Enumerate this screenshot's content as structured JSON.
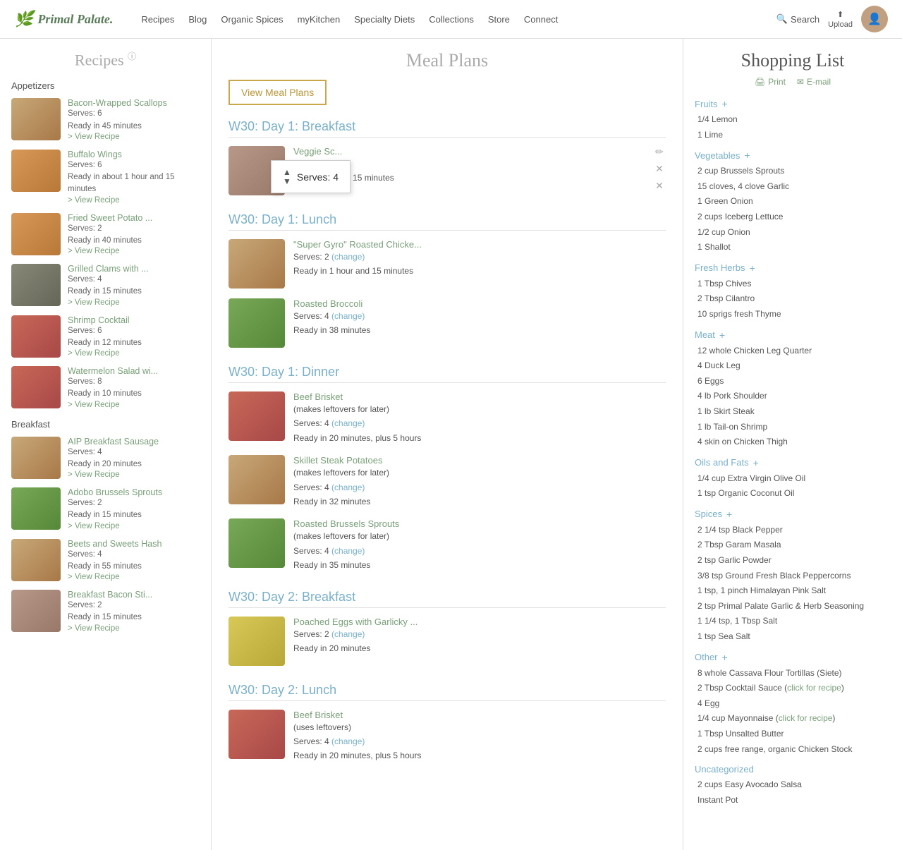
{
  "header": {
    "logo_text": "Primal Palate.",
    "nav_items": [
      {
        "label": "Recipes",
        "href": "#"
      },
      {
        "label": "Blog",
        "href": "#"
      },
      {
        "label": "Organic Spices",
        "href": "#"
      },
      {
        "label": "myKitchen",
        "href": "#"
      },
      {
        "label": "Specialty Diets",
        "href": "#"
      },
      {
        "label": "Collections",
        "href": "#"
      },
      {
        "label": "Store",
        "href": "#"
      },
      {
        "label": "Connect",
        "href": "#"
      }
    ],
    "search_label": "Search",
    "upload_label": "Upload"
  },
  "sidebar": {
    "title": "Recipes",
    "info_icon": "ⓘ",
    "sections": [
      {
        "label": "Appetizers",
        "recipes": [
          {
            "name": "Bacon-Wrapped Scallops",
            "serves": "Serves: 6",
            "ready": "Ready in 45 minutes",
            "thumb_class": "thumb-brown"
          },
          {
            "name": "Buffalo Wings",
            "serves": "Serves: 6",
            "ready": "Ready in about 1 hour and 15 minutes",
            "thumb_class": "thumb-orange"
          },
          {
            "name": "Fried Sweet Potato ...",
            "serves": "Serves: 2",
            "ready": "Ready in 40 minutes",
            "thumb_class": "thumb-orange"
          },
          {
            "name": "Grilled Clams with ...",
            "serves": "Serves: 4",
            "ready": "Ready in 15 minutes",
            "thumb_class": "thumb-dark"
          },
          {
            "name": "Shrimp Cocktail",
            "serves": "Serves: 6",
            "ready": "Ready in 12 minutes",
            "thumb_class": "thumb-red"
          },
          {
            "name": "Watermelon Salad wi...",
            "serves": "Serves: 8",
            "ready": "Ready in 10 minutes",
            "thumb_class": "thumb-red"
          }
        ]
      },
      {
        "label": "Breakfast",
        "recipes": [
          {
            "name": "AIP Breakfast Sausage",
            "serves": "Serves: 4",
            "ready": "Ready in 20 minutes",
            "thumb_class": "thumb-brown"
          },
          {
            "name": "Adobo Brussels Sprouts",
            "serves": "Serves: 2",
            "ready": "Ready in 15 minutes",
            "thumb_class": "thumb-green"
          },
          {
            "name": "Beets and Sweets Hash",
            "serves": "Serves: 4",
            "ready": "Ready in 55 minutes",
            "thumb_class": "thumb-brown"
          },
          {
            "name": "Breakfast Bacon Sti...",
            "serves": "Serves: 2",
            "ready": "Ready in 15 minutes",
            "thumb_class": "thumb-mixed"
          }
        ]
      }
    ],
    "view_recipe_label": "> View Recipe"
  },
  "meal_plan": {
    "title": "Meal Plans",
    "view_btn_label": "View Meal Plans",
    "days": [
      {
        "title": "W30: Day 1: Breakfast",
        "meals": [
          {
            "name": "Veggie Sc...",
            "serves": "Serves: 4",
            "ready": "Ready in about 15 minutes",
            "thumb_class": "thumb-mixed",
            "show_tooltip": true,
            "tooltip_serves": "Serves: 4"
          }
        ]
      },
      {
        "title": "W30: Day 1: Lunch",
        "meals": [
          {
            "name": "\"Super Gyro\" Roasted Chicke...",
            "serves": "Serves: 2",
            "change": "(change)",
            "ready": "Ready in 1 hour and 15 minutes",
            "thumb_class": "thumb-brown"
          },
          {
            "name": "Roasted Broccoli",
            "serves": "Serves: 4",
            "change": "(change)",
            "ready": "Ready in 38 minutes",
            "thumb_class": "thumb-green"
          }
        ]
      },
      {
        "title": "W30: Day 1: Dinner",
        "meals": [
          {
            "name": "Beef Brisket",
            "note": "(makes leftovers for later)",
            "serves": "Serves: 4",
            "change": "(change)",
            "ready": "Ready in 20 minutes, plus 5 hours",
            "thumb_class": "thumb-red"
          },
          {
            "name": "Skillet Steak Potatoes",
            "note": "(makes leftovers for later)",
            "serves": "Serves: 4",
            "change": "(change)",
            "ready": "Ready in 32 minutes",
            "thumb_class": "thumb-brown"
          },
          {
            "name": "Roasted Brussels Sprouts",
            "note": "(makes leftovers for later)",
            "serves": "Serves: 4",
            "change": "(change)",
            "ready": "Ready in 35 minutes",
            "thumb_class": "thumb-green"
          }
        ]
      },
      {
        "title": "W30: Day 2: Breakfast",
        "meals": [
          {
            "name": "Poached Eggs with Garlicky ...",
            "serves": "Serves: 2",
            "change": "(change)",
            "ready": "Ready in 20 minutes",
            "thumb_class": "thumb-yellow"
          }
        ]
      },
      {
        "title": "W30: Day 2: Lunch",
        "meals": [
          {
            "name": "Beef Brisket",
            "note": "(uses leftovers)",
            "serves": "Serves: 4",
            "change": "(change)",
            "ready": "Ready in 20 minutes, plus 5 hours",
            "thumb_class": "thumb-red"
          }
        ]
      }
    ]
  },
  "shopping_list": {
    "title": "Shopping List",
    "print_label": "Print",
    "email_label": "E-mail",
    "categories": [
      {
        "name": "Fruits",
        "items": [
          "1/4 Lemon",
          "1 Lime"
        ]
      },
      {
        "name": "Vegetables",
        "items": [
          "2 cup Brussels Sprouts",
          "15 cloves, 4 clove Garlic",
          "1 Green Onion",
          "2 cups Iceberg Lettuce",
          "1/2 cup Onion",
          "1 Shallot"
        ]
      },
      {
        "name": "Fresh Herbs",
        "items": [
          "1 Tbsp Chives",
          "2 Tbsp Cilantro",
          "10 sprigs fresh Thyme"
        ]
      },
      {
        "name": "Meat",
        "items": [
          "12 whole Chicken Leg Quarter",
          "4 Duck Leg",
          "6 Eggs",
          "4 lb Pork Shoulder",
          "1 lb Skirt Steak",
          "1 lb Tail-on Shrimp",
          "4 skin on Chicken Thigh"
        ]
      },
      {
        "name": "Oils and Fats",
        "items": [
          "1/4 cup Extra Virgin Olive Oil",
          "1 tsp Organic Coconut Oil"
        ]
      },
      {
        "name": "Spices",
        "items": [
          "2 1/4 tsp Black Pepper",
          "2 Tbsp Garam Masala",
          "2 tsp Garlic Powder",
          "3/8 tsp Ground Fresh Black Peppercorns",
          "1 tsp, 1 pinch Himalayan Pink Salt",
          "2 tsp Primal Palate Garlic & Herb Seasoning",
          "1 1/4 tsp, 1 Tbsp Salt",
          "1 tsp Sea Salt"
        ]
      },
      {
        "name": "Other",
        "items": [
          "8 whole Cassava Flour Tortillas (Siete)",
          "2 Tbsp Cocktail Sauce (click for recipe)",
          "4 Egg",
          "1/4 cup Mayonnaise (click for recipe)",
          "1 Tbsp Unsalted Butter",
          "2 cups free range, organic Chicken Stock"
        ]
      },
      {
        "name": "Uncategorized",
        "items": [
          "2 cups Easy Avocado Salsa",
          "Instant Pot"
        ]
      }
    ]
  }
}
